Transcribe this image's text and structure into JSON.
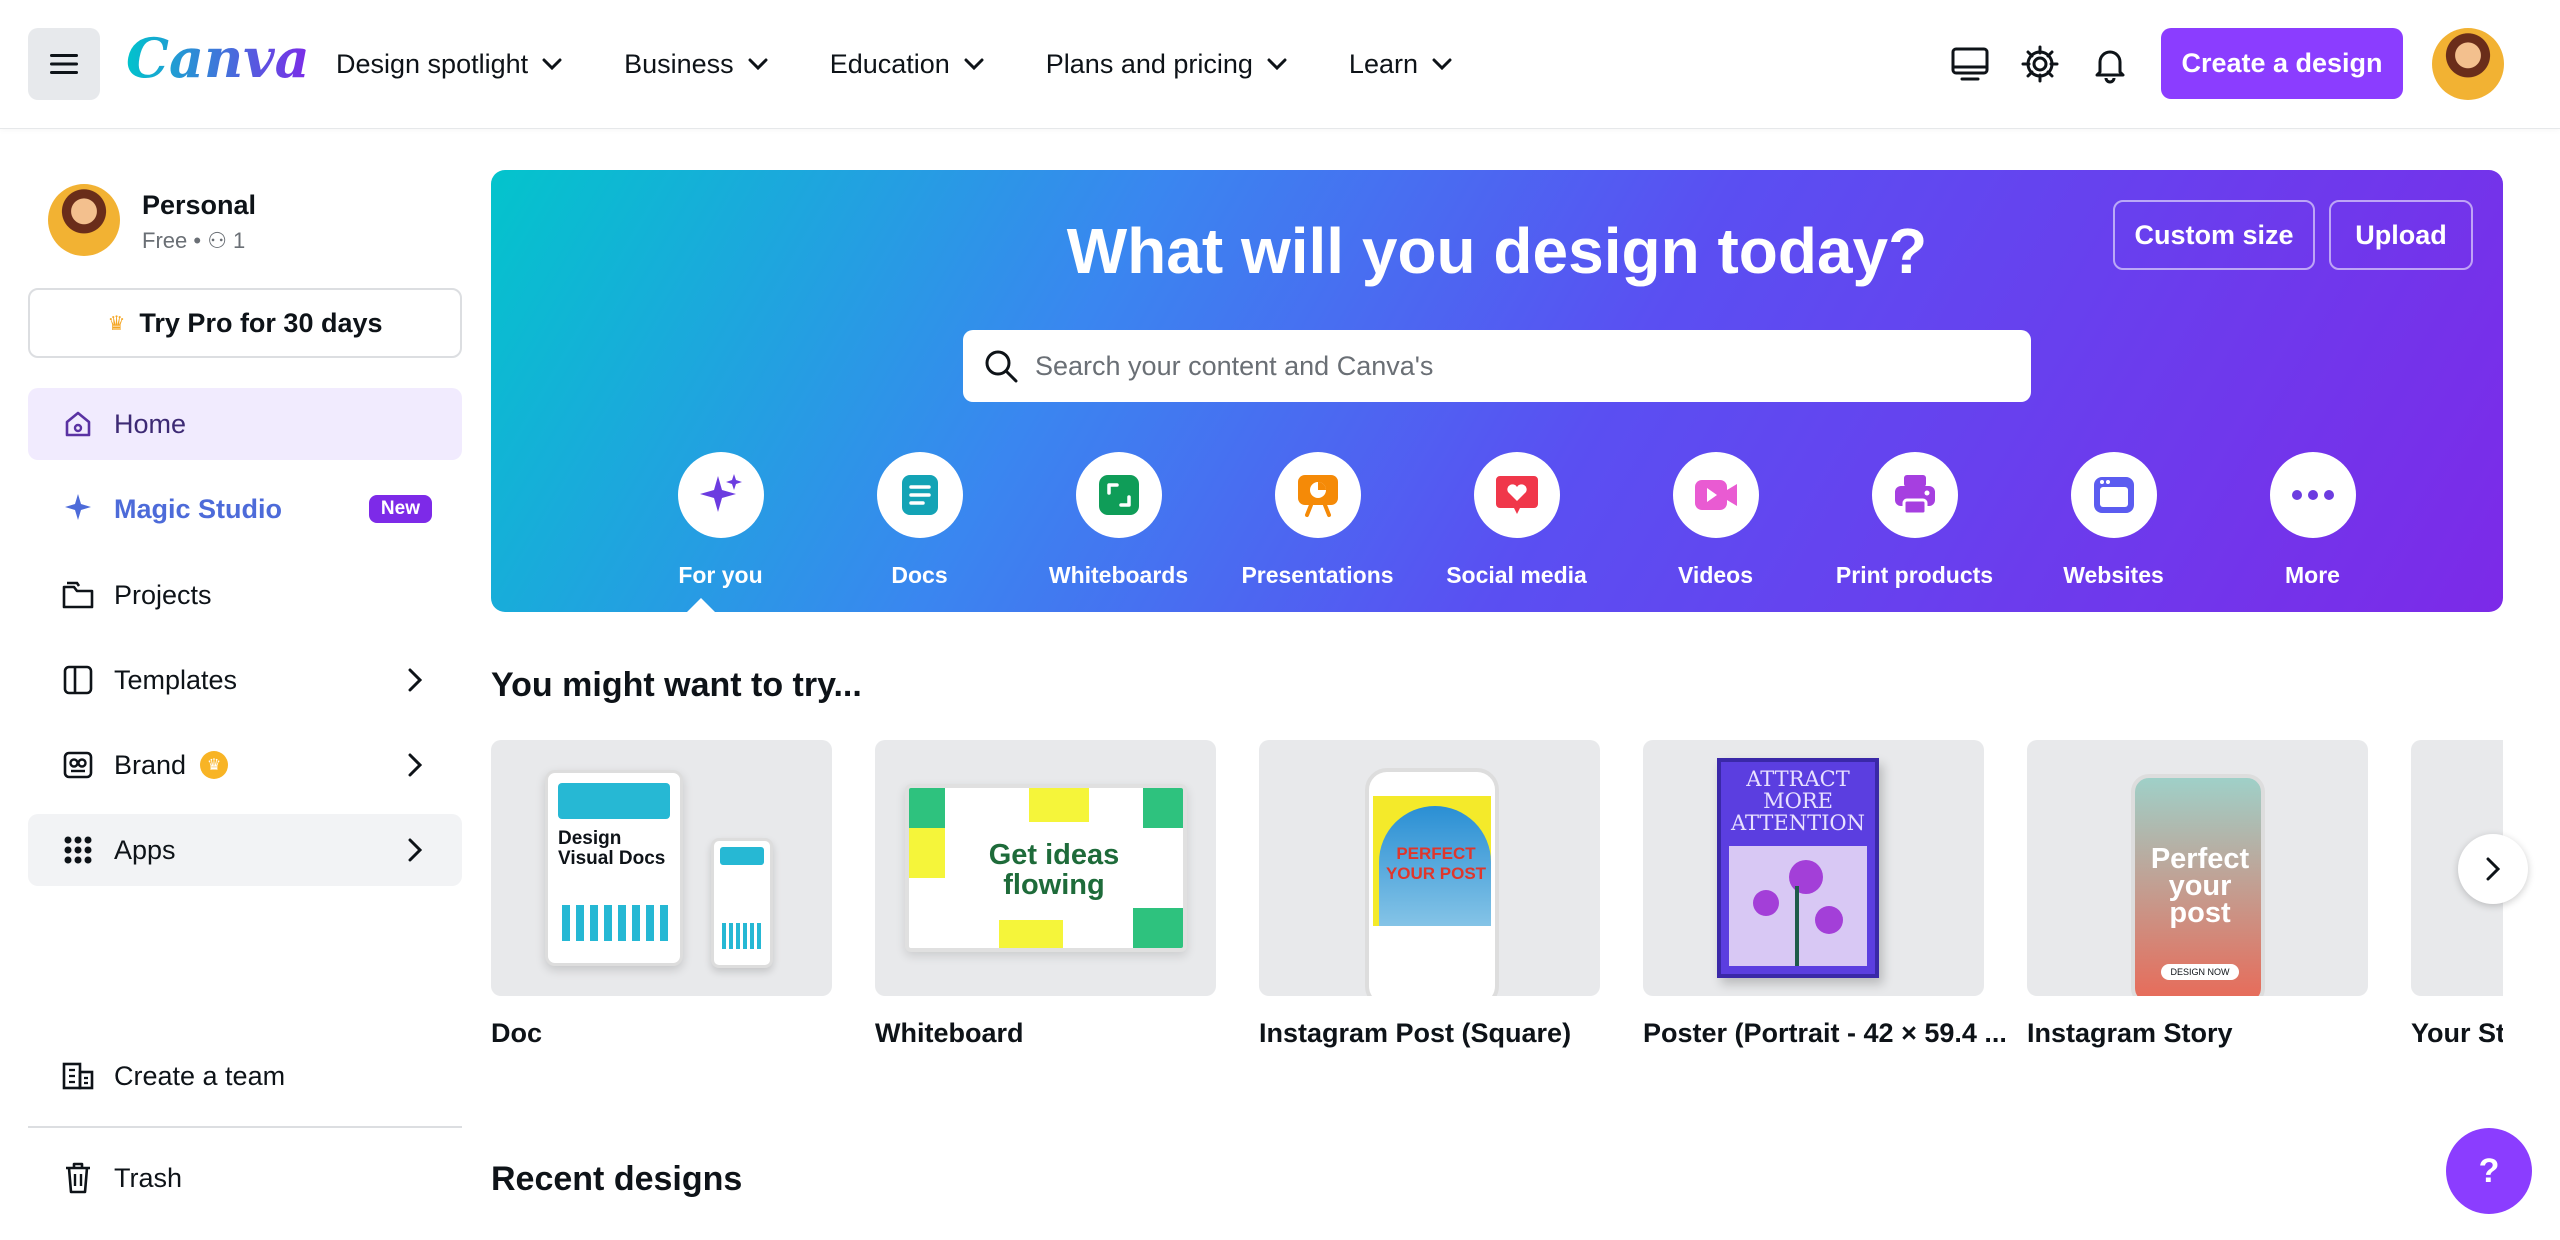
{
  "header": {
    "logo": "Canva",
    "nav": [
      {
        "label": "Design spotlight"
      },
      {
        "label": "Business"
      },
      {
        "label": "Education"
      },
      {
        "label": "Plans and pricing"
      },
      {
        "label": "Learn"
      }
    ],
    "create_label": "Create a design",
    "icons": [
      "desktop-icon",
      "gear-icon",
      "bell-icon"
    ]
  },
  "sidebar": {
    "profile": {
      "name": "Personal",
      "plan": "Free",
      "members": "1"
    },
    "try_pro": "Try Pro for 30 days",
    "items": [
      {
        "label": "Home"
      },
      {
        "label": "Magic Studio",
        "badge": "New"
      },
      {
        "label": "Projects"
      },
      {
        "label": "Templates"
      },
      {
        "label": "Brand"
      },
      {
        "label": "Apps"
      }
    ],
    "create_team": "Create a team",
    "trash": "Trash"
  },
  "hero": {
    "title": "What will you design today?",
    "custom_size": "Custom size",
    "upload": "Upload",
    "search_placeholder": "Search your content and Canva's",
    "categories": [
      {
        "label": "For you",
        "icon": "sparkle-icon",
        "color": "#7d2ae8"
      },
      {
        "label": "Docs",
        "icon": "doc-icon",
        "color": "#13a3b5"
      },
      {
        "label": "Whiteboards",
        "icon": "whiteboard-icon",
        "color": "#0f9d58"
      },
      {
        "label": "Presentations",
        "icon": "presentation-icon",
        "color": "#f58a07"
      },
      {
        "label": "Social media",
        "icon": "heart-icon",
        "color": "#f0374a"
      },
      {
        "label": "Videos",
        "icon": "video-icon",
        "color": "#e95bd2"
      },
      {
        "label": "Print products",
        "icon": "printer-icon",
        "color": "#a63fe0"
      },
      {
        "label": "Websites",
        "icon": "website-icon",
        "color": "#5b5cf0"
      },
      {
        "label": "More",
        "icon": "more-icon",
        "color": "#7d2ae8"
      }
    ]
  },
  "suggestions": {
    "title": "You might want to try...",
    "cards": [
      {
        "label": "Doc",
        "thumb_title": "Design Visual Docs"
      },
      {
        "label": "Whiteboard",
        "thumb_title": "Get ideas flowing"
      },
      {
        "label": "Instagram Post (Square)",
        "thumb_title": "PERFECT YOUR POST"
      },
      {
        "label": "Poster (Portrait - 42 × 59.4 ...",
        "thumb_title": "ATTRACT MORE ATTENTION"
      },
      {
        "label": "Instagram Story",
        "thumb_title": "Perfect your post",
        "thumb_button": "DESIGN NOW"
      },
      {
        "label": "Your Sto"
      }
    ]
  },
  "recent": {
    "title": "Recent designs"
  },
  "help_label": "?"
}
